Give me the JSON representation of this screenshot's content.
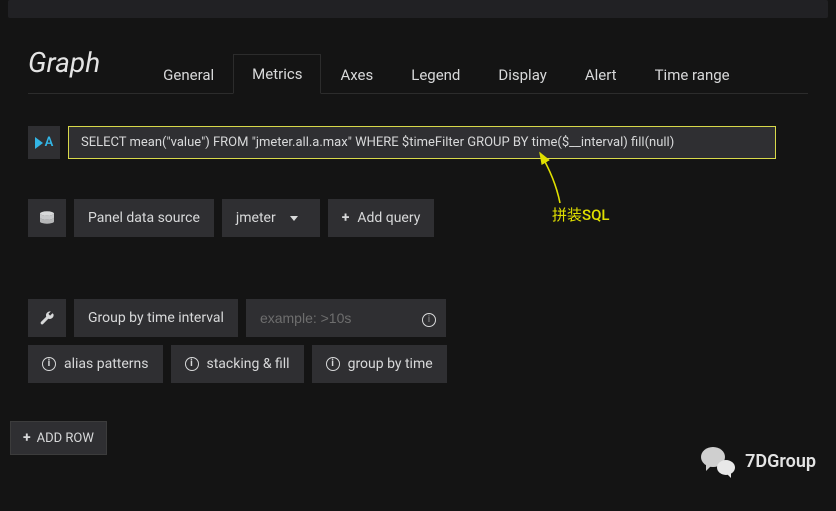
{
  "panel": {
    "title": "Graph"
  },
  "tabs": {
    "items": [
      {
        "label": "General",
        "active": false
      },
      {
        "label": "Metrics",
        "active": true
      },
      {
        "label": "Axes",
        "active": false
      },
      {
        "label": "Legend",
        "active": false
      },
      {
        "label": "Display",
        "active": false
      },
      {
        "label": "Alert",
        "active": false
      },
      {
        "label": "Time range",
        "active": false
      }
    ]
  },
  "query": {
    "letter": "A",
    "sql": "SELECT mean(\"value\") FROM \"jmeter.all.a.max\" WHERE $timeFilter GROUP BY time($__interval) fill(null)"
  },
  "datasource": {
    "label": "Panel data source",
    "value": "jmeter",
    "add_query_label": "Add query"
  },
  "interval": {
    "label": "Group by time interval",
    "placeholder": "example: >10s"
  },
  "help": {
    "alias": "alias patterns",
    "stacking": "stacking & fill",
    "groupby": "group by time"
  },
  "footer": {
    "add_row": "ADD ROW"
  },
  "annotation": {
    "text": "拼装SQL"
  },
  "watermark": {
    "text": "7DGroup"
  }
}
